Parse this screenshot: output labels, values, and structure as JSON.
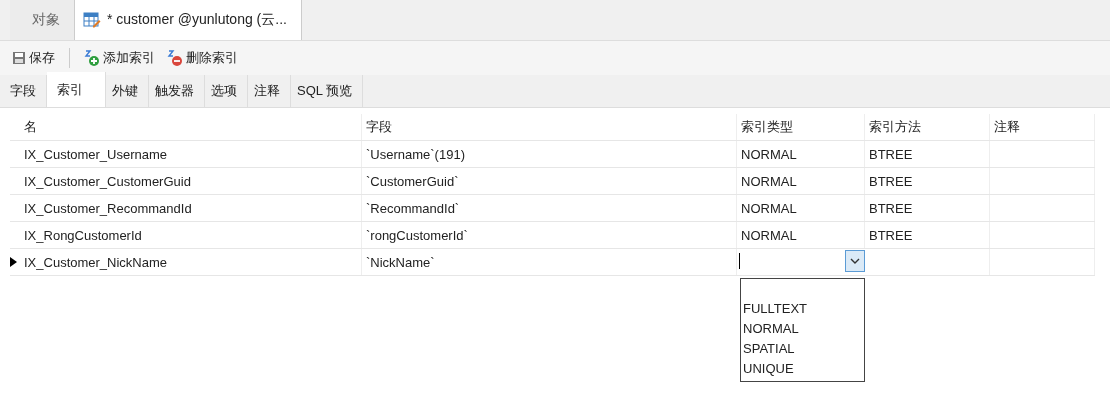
{
  "doc_tabs": [
    {
      "label": "对象",
      "selected": false,
      "icon": false
    },
    {
      "label": "* customer @yunlutong (云...",
      "selected": true,
      "icon": true
    }
  ],
  "toolbar": [
    {
      "kind": "save",
      "label": "保存"
    },
    {
      "kind": "add",
      "label": "添加索引"
    },
    {
      "kind": "delete",
      "label": "删除索引"
    }
  ],
  "tabs": [
    {
      "label": "字段",
      "selected": false
    },
    {
      "label": "索引",
      "selected": true
    },
    {
      "label": "外键",
      "selected": false
    },
    {
      "label": "触发器",
      "selected": false
    },
    {
      "label": "选项",
      "selected": false
    },
    {
      "label": "注释",
      "selected": false
    },
    {
      "label": "SQL 预览",
      "selected": false
    }
  ],
  "table": {
    "columns": [
      "名",
      "字段",
      "索引类型",
      "索引方法",
      "注释"
    ],
    "rows": [
      {
        "name": "IX_Customer_Username",
        "field": "`Username`(191)",
        "index_type": "NORMAL",
        "index_method": "BTREE",
        "current": false
      },
      {
        "name": "IX_Customer_CustomerGuid",
        "field": "`CustomerGuid`",
        "index_type": "NORMAL",
        "index_method": "BTREE",
        "current": false
      },
      {
        "name": "IX_Customer_RecommandId",
        "field": "`RecommandId`",
        "index_type": "NORMAL",
        "index_method": "BTREE",
        "current": false
      },
      {
        "name": "IX_RongCustomerId",
        "field": "`rongCustomerId`",
        "index_type": "NORMAL",
        "index_method": "BTREE",
        "current": false
      },
      {
        "name": "IX_Customer_NickName",
        "field": "`NickName`",
        "current": true
      }
    ],
    "dropdown": {
      "open": true,
      "options": [
        "FULLTEXT",
        "NORMAL",
        "SPATIAL",
        "UNIQUE"
      ]
    }
  }
}
